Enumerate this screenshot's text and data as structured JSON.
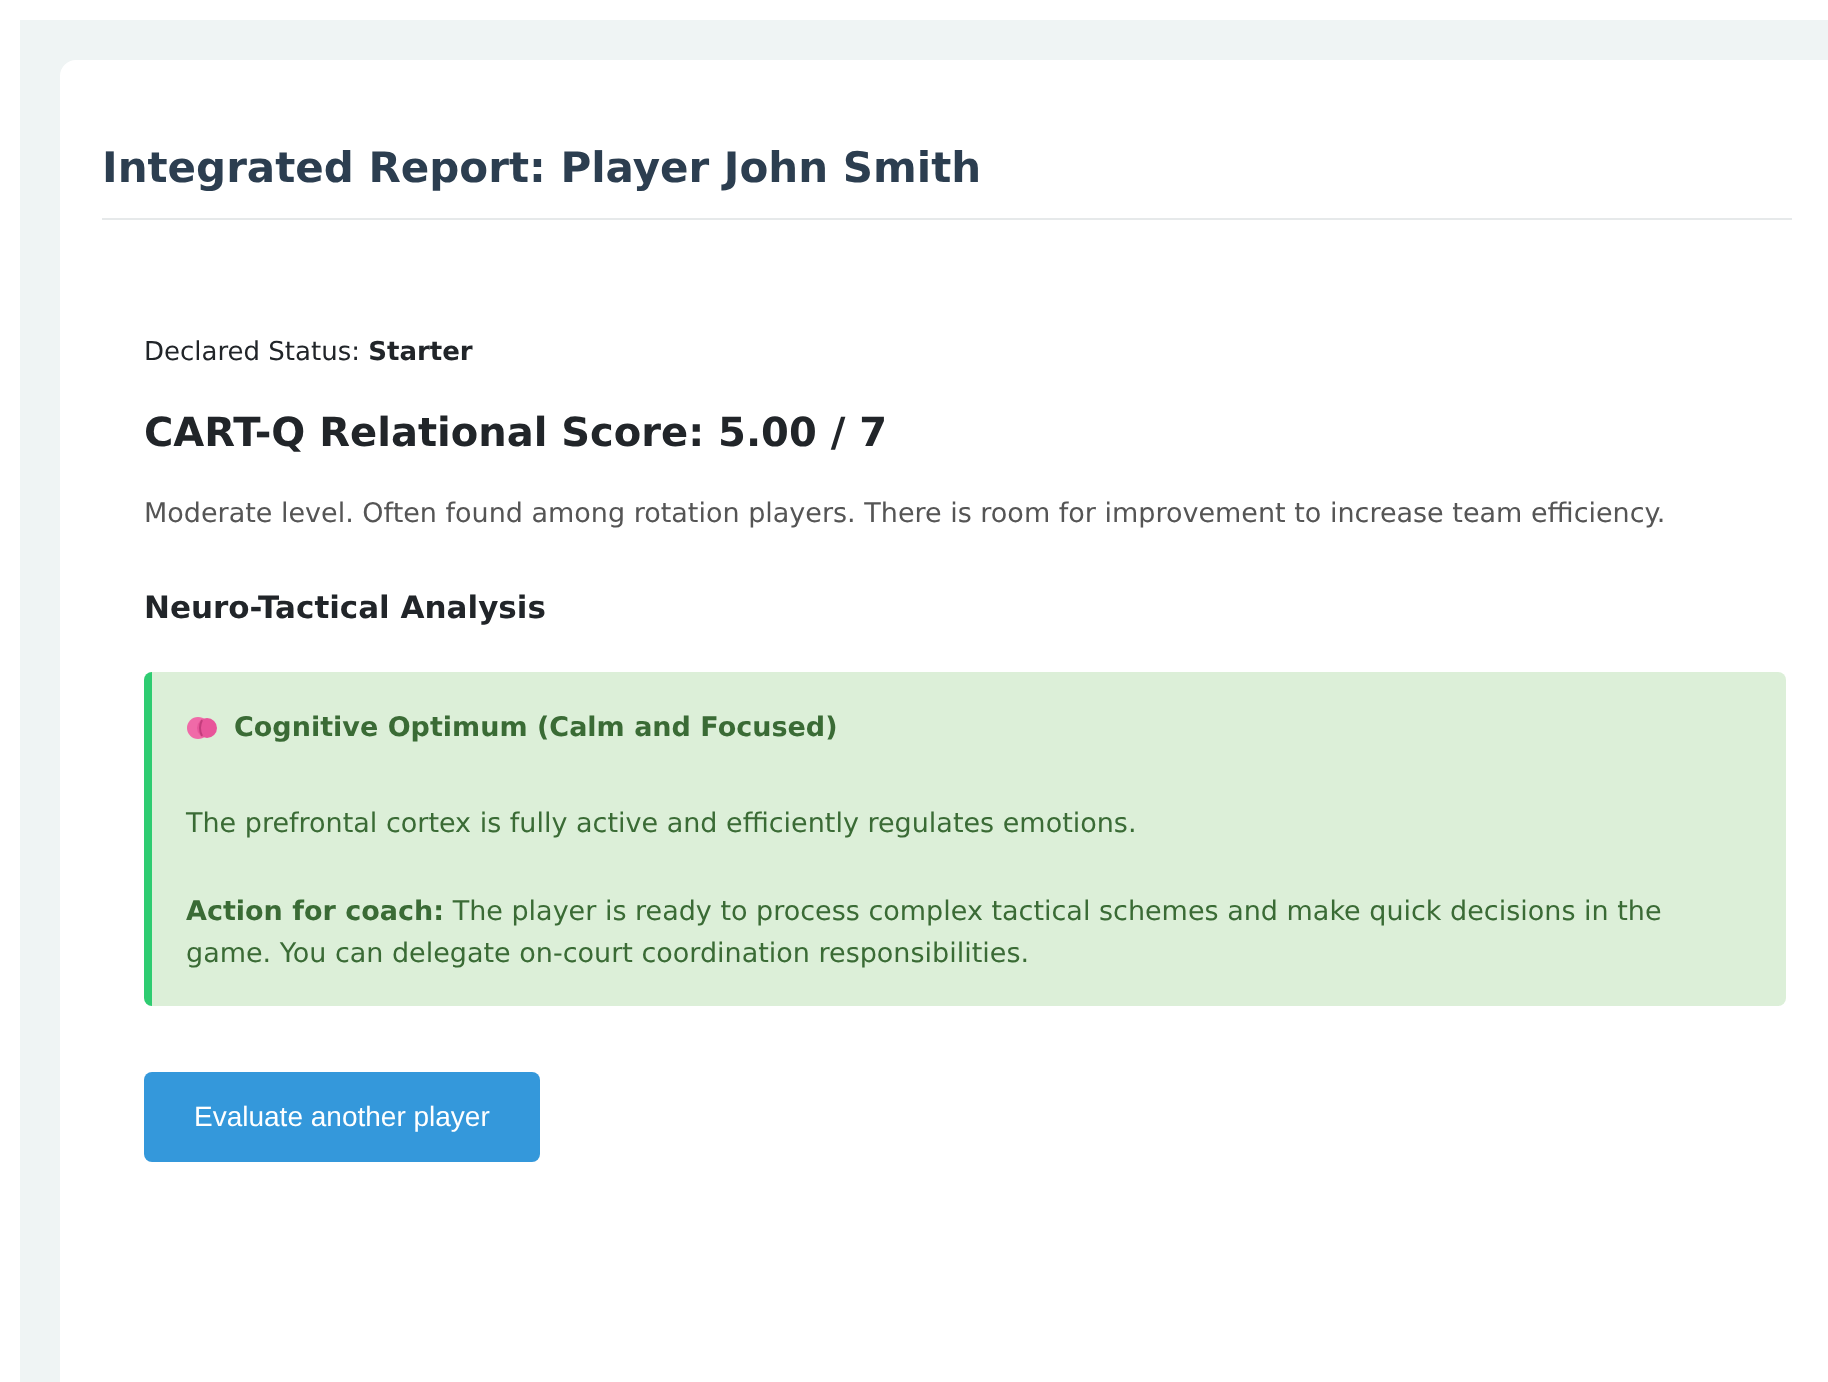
{
  "report": {
    "title": "Integrated Report: Player John Smith",
    "status_label": "Declared Status:",
    "status_value": "Starter",
    "score_heading": "CART-Q Relational Score: 5.00 / 7",
    "score_description": "Moderate level. Often found among rotation players. There is room for improvement to increase team efficiency.",
    "analysis_heading": "Neuro-Tactical Analysis",
    "analysis": {
      "title": "Cognitive Optimum (Calm and Focused)",
      "summary": "The prefrontal cortex is fully active and efficiently regulates emotions.",
      "action": "**Action for coach:** The player is ready to process complex tactical schemes and make quick decisions in the game. You can delegate on-court coordination responsibilities."
    },
    "button": "Evaluate another player"
  }
}
